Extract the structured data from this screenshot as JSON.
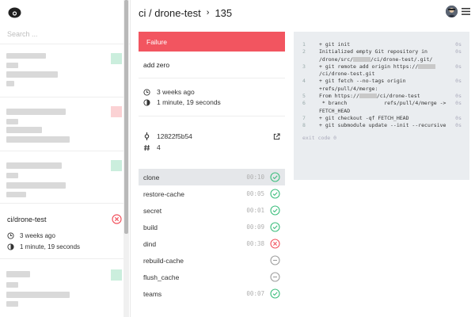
{
  "search": {
    "placeholder": "Search ..."
  },
  "breadcrumb": {
    "repo": "ci / drone-test",
    "separator": "›",
    "build_number": "135"
  },
  "sidebar": {
    "active_item": {
      "name": "ci/drone-test",
      "started": "3 weeks ago",
      "duration": "1 minute, 19 seconds",
      "status": "failure"
    }
  },
  "build": {
    "status_label": "Failure",
    "status_color": "#f25560",
    "message": "add zero",
    "started": "3 weeks ago",
    "duration": "1 minute, 19 seconds",
    "commit_sha": "12822f5b54",
    "pr_number": "4"
  },
  "steps": [
    {
      "name": "clone",
      "duration": "00:10",
      "status": "success"
    },
    {
      "name": "restore-cache",
      "duration": "00:05",
      "status": "success"
    },
    {
      "name": "secret",
      "duration": "00:01",
      "status": "success"
    },
    {
      "name": "build",
      "duration": "00:09",
      "status": "success"
    },
    {
      "name": "dind",
      "duration": "00:38",
      "status": "failure"
    },
    {
      "name": "rebuild-cache",
      "duration": "",
      "status": "skipped"
    },
    {
      "name": "flush_cache",
      "duration": "",
      "status": "skipped"
    },
    {
      "name": "teams",
      "duration": "00:07",
      "status": "success"
    }
  ],
  "log": {
    "lines": [
      {
        "n": "1",
        "text": "+ git init",
        "t": "0s"
      },
      {
        "n": "2",
        "text": "Initialized empty Git repository in /drone/src/",
        "text2": "/ci/drone-test/.git/",
        "t": "0s"
      },
      {
        "n": "3",
        "text": "+ git remote add origin https://",
        "text2": "/ci/drone-test.git",
        "t": "0s"
      },
      {
        "n": "4",
        "text": "+ git fetch --no-tags origin +refs/pull/4/merge:",
        "t": "0s"
      },
      {
        "n": "5",
        "text": "From https://",
        "text2": "/ci/drone-test",
        "t": "0s"
      },
      {
        "n": "6",
        "text": " * branch            refs/pull/4/merge -> FETCH_HEAD",
        "t": "0s"
      },
      {
        "n": "7",
        "text": "+ git checkout -qf FETCH_HEAD",
        "t": "0s"
      },
      {
        "n": "8",
        "text": "+ git submodule update --init --recursive",
        "t": "0s"
      }
    ],
    "exit": "exit code 0"
  },
  "colors": {
    "success": "#3fbf7f",
    "failure": "#f25560",
    "skipped": "#a0a0a0"
  }
}
